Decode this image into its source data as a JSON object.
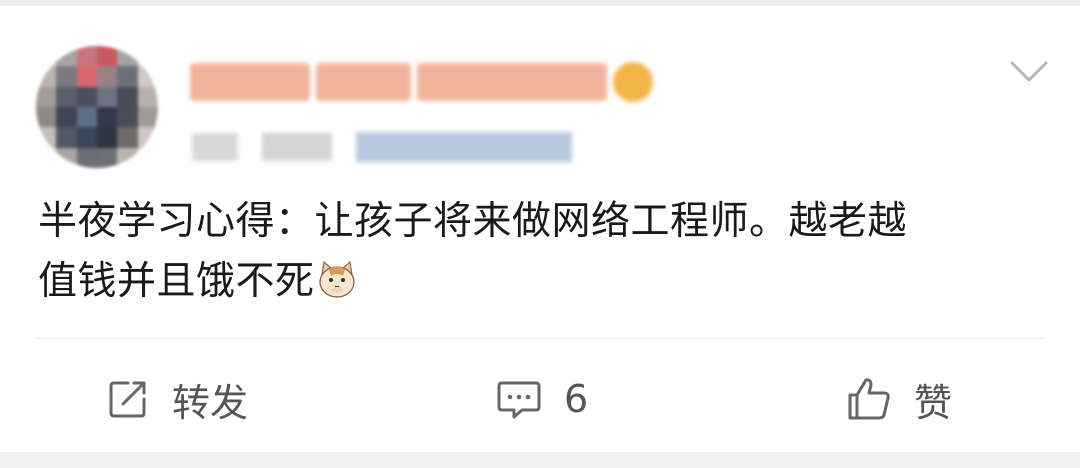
{
  "post": {
    "text_line1": "半夜学习心得：让孩子将来做网络工程师。越老越",
    "text_line2": "值钱并且饿不死",
    "emoji": "cat-face-emoji"
  },
  "header": {
    "menu_icon": "chevron-down-icon",
    "avatar_colors": [
      "#d9d2cc",
      "#a9a3a6",
      "#c8747a",
      "#c95863",
      "#a7a2a5",
      "#e0dbd6",
      "#b9b3ae",
      "#7c7a80",
      "#d86770",
      "#9d7f86",
      "#6b6f79",
      "#cfcac6",
      "#a39d98",
      "#5a5f6a",
      "#4b4f5c",
      "#6d7381",
      "#494c55",
      "#b7b2ad",
      "#8e8a86",
      "#3f4654",
      "#5d6e86",
      "#31384a",
      "#484d58",
      "#a09b96",
      "#c3beba",
      "#535866",
      "#3b465a",
      "#2e3442",
      "#6d6a6a",
      "#cdc8c4",
      "#e2ddd9",
      "#a8a3a0",
      "#6c6e74",
      "#707177",
      "#b9b4b0",
      "#e6e2de"
    ],
    "username_color": "#f1b39c",
    "vip_badge_color": "#f4b44a",
    "meta_link_color": "#b6c9de"
  },
  "actions": {
    "repost": {
      "label": "转发",
      "icon": "repost-icon"
    },
    "comment": {
      "label": "6",
      "icon": "comment-icon"
    },
    "like": {
      "label": "赞",
      "icon": "thumbs-up-icon"
    }
  },
  "colors": {
    "text": "#1a1a1a",
    "action_text": "#555555",
    "icon": "#666666",
    "divider": "#ececec"
  }
}
